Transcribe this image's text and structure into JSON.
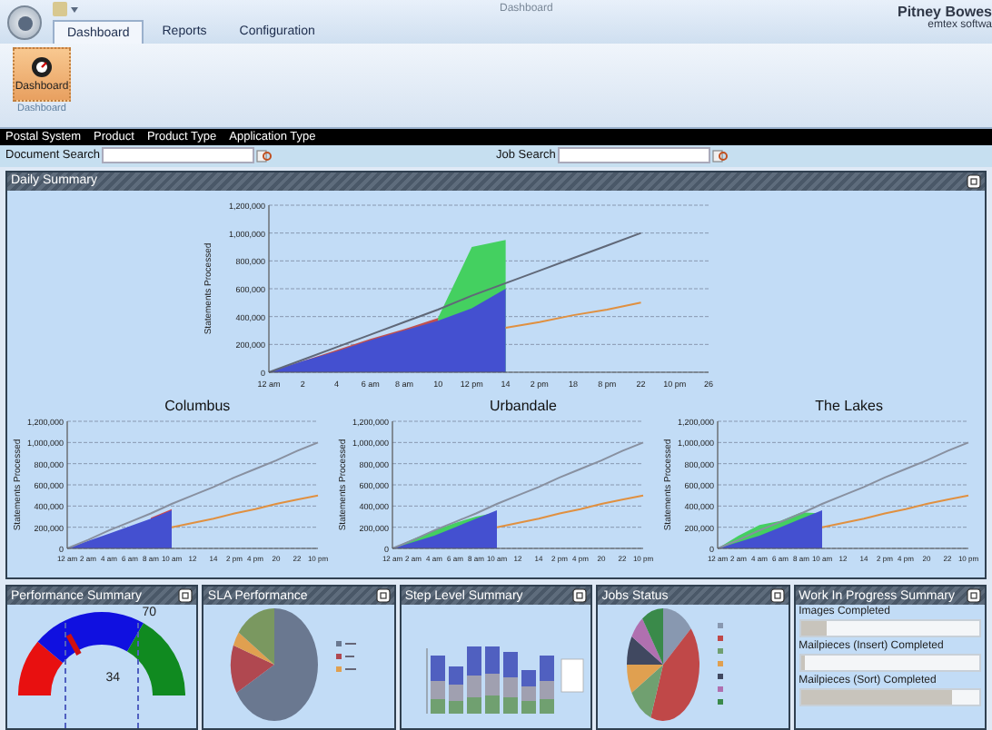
{
  "window": {
    "title": "Dashboard"
  },
  "ribbon": {
    "tabs": [
      {
        "label": "Dashboard",
        "selected": true
      },
      {
        "label": "Reports",
        "selected": false
      },
      {
        "label": "Configuration",
        "selected": false
      }
    ],
    "buttons": [
      {
        "label": "Dashboard",
        "selected": true
      }
    ],
    "group_label": "Dashboard"
  },
  "brand": {
    "name": "Pitney Bowes",
    "product": "emtex softwa"
  },
  "menu": [
    "Postal System",
    "Product",
    "Product Type",
    "Application Type"
  ],
  "search": [
    {
      "label": "Document Search"
    },
    {
      "label": "Job Search"
    }
  ],
  "daily_summary": {
    "title": "Daily Summary",
    "chart_data": {
      "type": "area",
      "grid": true,
      "ylabel": "Statements Processed",
      "categories": [
        "12 am",
        "2",
        "4",
        "6 am",
        "8 am",
        "10",
        "12 pm",
        "14",
        "2 pm",
        "18",
        "8 pm",
        "22",
        "10 pm",
        "26"
      ],
      "ylim": [
        0,
        1200000
      ],
      "yticks": [
        {
          "value": 0,
          "label": "0"
        },
        {
          "value": 200000,
          "label": "200,000"
        },
        {
          "value": 400000,
          "label": "400,000"
        },
        {
          "value": 600000,
          "label": "600,000"
        },
        {
          "value": 800000,
          "label": "800,000"
        },
        {
          "value": 1000000,
          "label": "1,000,000"
        },
        {
          "value": 1200000,
          "label": "1,200,000"
        }
      ],
      "series": [
        {
          "type": "area",
          "color": "#44d060",
          "values": [
            null,
            null,
            null,
            null,
            null,
            390000,
            900000,
            950000,
            null,
            null,
            null,
            null,
            null,
            null
          ]
        },
        {
          "type": "area",
          "color": "#c05050",
          "values": [
            0,
            80000,
            160000,
            240000,
            310000,
            390000,
            null,
            null,
            null,
            null,
            null,
            null,
            null,
            null
          ]
        },
        {
          "type": "area",
          "color": "#4450d0",
          "values": [
            0,
            80000,
            150000,
            230000,
            300000,
            370000,
            460000,
            600000,
            null,
            null,
            null,
            null,
            null,
            null
          ]
        },
        {
          "type": "line",
          "color": "#606878",
          "values": [
            0,
            90000,
            180000,
            270000,
            360000,
            450000,
            550000,
            640000,
            730000,
            820000,
            910000,
            1000000,
            null,
            null
          ]
        },
        {
          "type": "line",
          "color": "#e09040",
          "values": [
            null,
            null,
            null,
            null,
            null,
            null,
            null,
            320000,
            360000,
            410000,
            450000,
            500000,
            null,
            null
          ]
        }
      ]
    },
    "sites": [
      {
        "chart_data": {
          "type": "area",
          "grid": true,
          "title": "Columbus",
          "ylabel": "Statements Processed",
          "categories": [
            "12 am",
            "2 am",
            "4 am",
            "6 am",
            "8 am",
            "10 am",
            "12",
            "14",
            "2 pm",
            "4 pm",
            "20",
            "22",
            "10 pm"
          ],
          "ylim": [
            0,
            1200000
          ],
          "yticks": [
            {
              "value": 0,
              "label": "0"
            },
            {
              "value": 200000,
              "label": "200,000"
            },
            {
              "value": 400000,
              "label": "400,000"
            },
            {
              "value": 600000,
              "label": "600,000"
            },
            {
              "value": 800000,
              "label": "800,000"
            },
            {
              "value": 1000000,
              "label": "1,000,000"
            },
            {
              "value": 1200000,
              "label": "1,200,000"
            }
          ],
          "series": [
            {
              "type": "area",
              "color": "#d04848",
              "values": [
                null,
                null,
                null,
                null,
                290000,
                370000,
                null,
                null,
                null,
                null,
                null,
                null,
                null
              ]
            },
            {
              "type": "area",
              "color": "#4450d0",
              "values": [
                0,
                70000,
                140000,
                210000,
                280000,
                360000,
                null,
                null,
                null,
                null,
                null,
                null,
                null
              ]
            },
            {
              "type": "line",
              "color": "#8890a0",
              "values": [
                0,
                80000,
                170000,
                250000,
                330000,
                420000,
                500000,
                580000,
                670000,
                750000,
                830000,
                920000,
                1000000
              ]
            },
            {
              "type": "line",
              "color": "#e09040",
              "values": [
                null,
                null,
                null,
                null,
                null,
                200000,
                240000,
                280000,
                330000,
                370000,
                420000,
                460000,
                500000
              ]
            }
          ]
        }
      },
      {
        "chart_data": {
          "type": "area",
          "grid": true,
          "title": "Urbandale",
          "ylabel": "Statements Processed",
          "categories": [
            "12 am",
            "2 am",
            "4 am",
            "6 am",
            "8 am",
            "10 am",
            "12",
            "14",
            "2 pm",
            "4 pm",
            "20",
            "22",
            "10 pm"
          ],
          "ylim": [
            0,
            1200000
          ],
          "yticks": [
            {
              "value": 0,
              "label": "0"
            },
            {
              "value": 200000,
              "label": "200,000"
            },
            {
              "value": 400000,
              "label": "400,000"
            },
            {
              "value": 600000,
              "label": "600,000"
            },
            {
              "value": 800000,
              "label": "800,000"
            },
            {
              "value": 1000000,
              "label": "1,000,000"
            },
            {
              "value": 1200000,
              "label": "1,200,000"
            }
          ],
          "series": [
            {
              "type": "area",
              "color": "#44d060",
              "values": [
                0,
                90000,
                170000,
                240000,
                300000,
                340000,
                null,
                null,
                null,
                null,
                null,
                null,
                null
              ]
            },
            {
              "type": "area",
              "color": "#4450d0",
              "values": [
                0,
                60000,
                120000,
                200000,
                280000,
                360000,
                null,
                null,
                null,
                null,
                null,
                null,
                null
              ]
            },
            {
              "type": "line",
              "color": "#8890a0",
              "values": [
                0,
                80000,
                170000,
                250000,
                330000,
                420000,
                500000,
                580000,
                670000,
                750000,
                830000,
                920000,
                1000000
              ]
            },
            {
              "type": "line",
              "color": "#e09040",
              "values": [
                null,
                null,
                null,
                null,
                null,
                200000,
                240000,
                280000,
                330000,
                370000,
                420000,
                460000,
                500000
              ]
            }
          ]
        }
      },
      {
        "chart_data": {
          "type": "area",
          "grid": true,
          "title": "The Lakes",
          "ylabel": "Statements Processed",
          "categories": [
            "12 am",
            "2 am",
            "4 am",
            "6 am",
            "8 am",
            "10 am",
            "12",
            "14",
            "2 pm",
            "4 pm",
            "20",
            "22",
            "10 pm"
          ],
          "ylim": [
            0,
            1200000
          ],
          "yticks": [
            {
              "value": 0,
              "label": "0"
            },
            {
              "value": 200000,
              "label": "200,000"
            },
            {
              "value": 400000,
              "label": "400,000"
            },
            {
              "value": 600000,
              "label": "600,000"
            },
            {
              "value": 800000,
              "label": "800,000"
            },
            {
              "value": 1000000,
              "label": "1,000,000"
            },
            {
              "value": 1200000,
              "label": "1,200,000"
            }
          ],
          "series": [
            {
              "type": "area",
              "color": "#44d060",
              "values": [
                0,
                120000,
                220000,
                260000,
                340000,
                330000,
                null,
                null,
                null,
                null,
                null,
                null,
                null
              ]
            },
            {
              "type": "area",
              "color": "#4450d0",
              "values": [
                0,
                60000,
                120000,
                200000,
                280000,
                360000,
                null,
                null,
                null,
                null,
                null,
                null,
                null
              ]
            },
            {
              "type": "line",
              "color": "#8890a0",
              "values": [
                0,
                80000,
                170000,
                250000,
                330000,
                420000,
                500000,
                580000,
                670000,
                750000,
                830000,
                920000,
                1000000
              ]
            },
            {
              "type": "line",
              "color": "#e09040",
              "values": [
                null,
                null,
                null,
                null,
                null,
                200000,
                240000,
                280000,
                330000,
                370000,
                420000,
                460000,
                500000
              ]
            }
          ]
        }
      }
    ]
  },
  "panels": [
    {
      "kind": "gauge",
      "title": "Performance Summary",
      "reading": "34",
      "max_label": "70",
      "level": 0.34
    },
    {
      "kind": "pie",
      "title": "SLA Performance"
    },
    {
      "kind": "bars",
      "title": "Step Level Summary"
    },
    {
      "kind": "pie_multi",
      "title": "Jobs Status"
    },
    {
      "kind": "progress",
      "title": "Work In Progress Summary",
      "items": [
        {
          "label": "Images Completed",
          "level": 0.15
        },
        {
          "label": "Mailpieces (Insert) Completed",
          "level": 0.02
        },
        {
          "label": "Mailpieces (Sort) Completed",
          "level": 0.85
        }
      ]
    }
  ]
}
